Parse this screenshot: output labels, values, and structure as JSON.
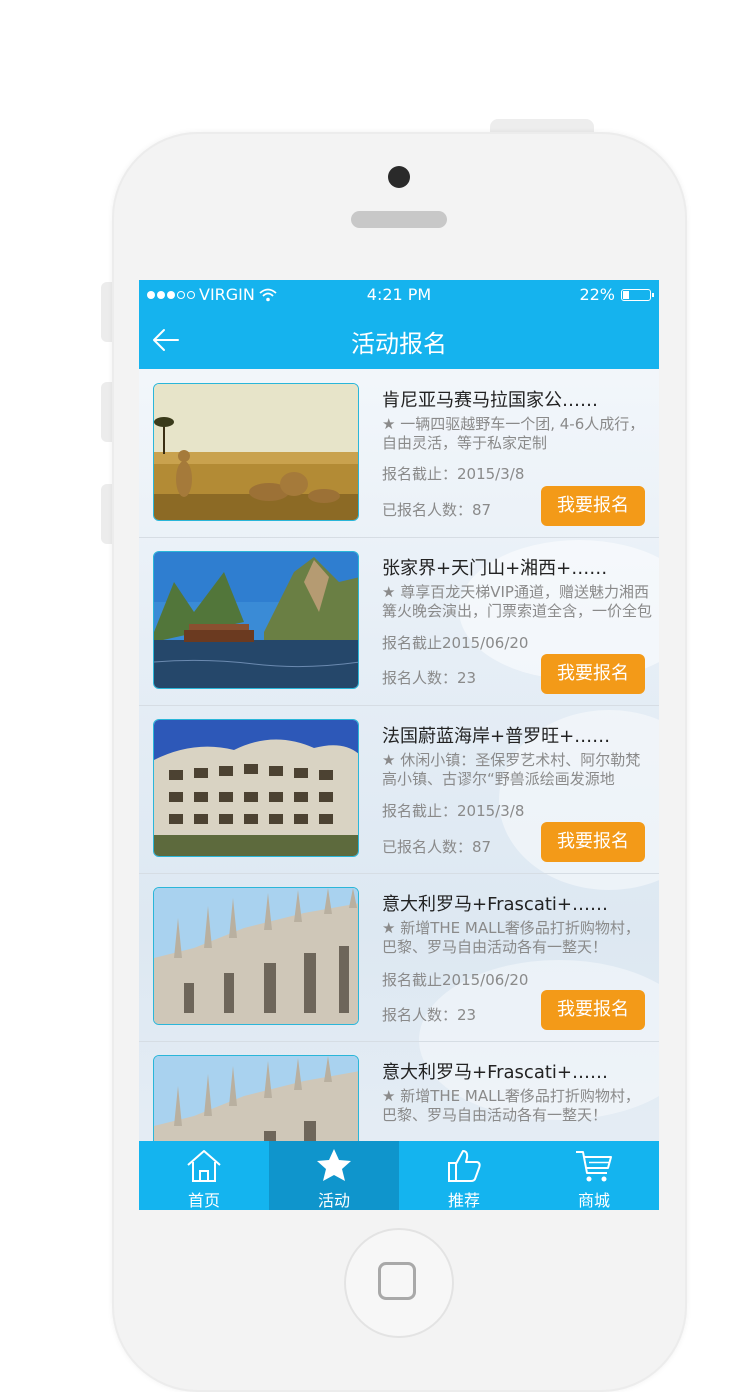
{
  "status_bar": {
    "carrier": "VIRGIN",
    "time": "4:21 PM",
    "battery": "22%",
    "signal_icon": "signal-dots-icon",
    "wifi_icon": "wifi-icon",
    "battery_icon": "battery-icon"
  },
  "nav": {
    "title": "活动报名",
    "back_icon": "back-arrow-icon"
  },
  "activities": [
    {
      "title": "肯尼亚马赛马拉国家公……",
      "desc": "★ 一辆四驱越野车一个团, 4-6人成行，自由灵活，等于私家定制",
      "deadline": "报名截止：2015/3/8",
      "count": "已报名人数：87",
      "button": "我要报名",
      "image": "cheetahs-savanna-photo"
    },
    {
      "title": "张家界+天门山+湘西+……",
      "desc": "★ 尊享百龙天梯VIP通道，赠送魅力湘西篝火晚会演出，门票索道全含，一价全包",
      "deadline": "报名截止2015/06/20",
      "count": "报名人数：23",
      "button": "我要报名",
      "image": "zhangjiajie-lake-photo"
    },
    {
      "title": "法国蔚蓝海岸+普罗旺+……",
      "desc": "★ 休闲小镇：圣保罗艺术村、阿尔勒梵高小镇、古谬尔“野兽派绘画发源地",
      "deadline": "报名截止：2015/3/8",
      "count": "已报名人数：87",
      "button": "我要报名",
      "image": "casa-mila-photo"
    },
    {
      "title": "意大利罗马+Frascati+……",
      "desc": "★ 新增THE MALL奢侈品打折购物村，巴黎、罗马自由活动各有一整天！",
      "deadline": "报名截止2015/06/20",
      "count": "报名人数：23",
      "button": "我要报名",
      "image": "milan-cathedral-photo"
    },
    {
      "title": "意大利罗马+Frascati+……",
      "desc": "★ 新增THE MALL奢侈品打折购物村，巴黎、罗马自由活动各有一整天！",
      "deadline": "",
      "count": "",
      "button": "",
      "image": "milan-cathedral-photo"
    }
  ],
  "tabs": [
    {
      "label": "首页",
      "icon": "home-icon",
      "active": false
    },
    {
      "label": "活动",
      "icon": "star-icon",
      "active": true
    },
    {
      "label": "推荐",
      "icon": "thumbs-up-icon",
      "active": false
    },
    {
      "label": "商城",
      "icon": "cart-icon",
      "active": false
    }
  ],
  "colors": {
    "primary": "#15b3ee",
    "tab_active": "#0f95cc",
    "button": "#f39a18"
  }
}
